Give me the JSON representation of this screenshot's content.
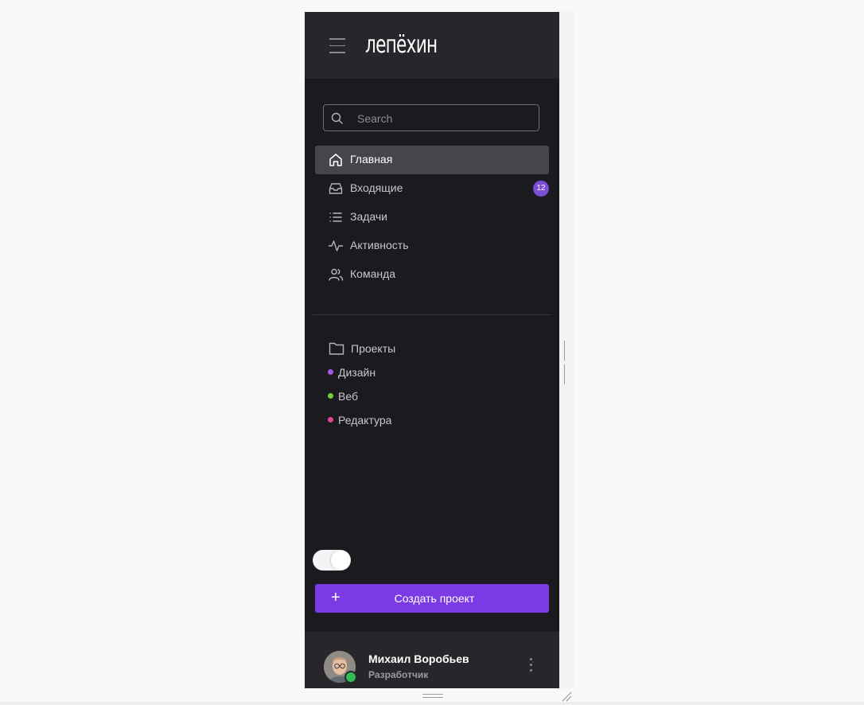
{
  "header": {
    "logo_text": "лепёхин"
  },
  "search": {
    "placeholder": "Search"
  },
  "nav": {
    "items": [
      {
        "label": "Главная",
        "icon": "home-icon",
        "active": true
      },
      {
        "label": "Входящие",
        "icon": "inbox-icon",
        "badge": "12"
      },
      {
        "label": "Задачи",
        "icon": "list-icon"
      },
      {
        "label": "Активность",
        "icon": "activity-icon"
      },
      {
        "label": "Команда",
        "icon": "users-icon"
      }
    ]
  },
  "projects": {
    "title": "Проекты",
    "items": [
      {
        "label": "Дизайн",
        "color": "#a659e8"
      },
      {
        "label": "Веб",
        "color": "#6fcf3a"
      },
      {
        "label": "Редактура",
        "color": "#e3439a"
      }
    ]
  },
  "theme_toggle": {
    "on": true
  },
  "create_button": {
    "label": "Создать проект",
    "plus": "+"
  },
  "user": {
    "name": "Михаил Воробьев",
    "role": "Разработчик",
    "status": "online"
  },
  "colors": {
    "accent": "#7b3ae4",
    "badge": "#7c4dd9",
    "sidebar_bg": "#1b1a1f",
    "header_bg": "#27262b"
  }
}
